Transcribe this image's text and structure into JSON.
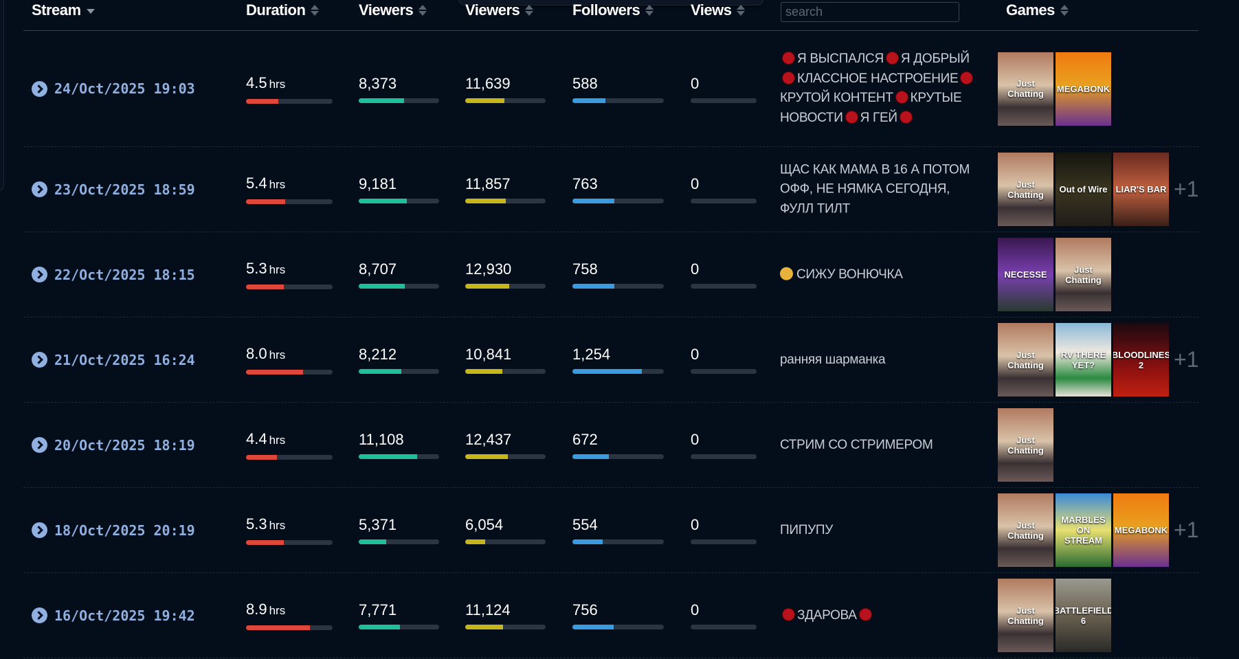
{
  "header": {
    "stream": "Stream",
    "duration": "Duration",
    "viewers_avg": "Viewers",
    "viewers_peak": "Viewers",
    "followers": "Followers",
    "views": "Views",
    "search_placeholder": "search",
    "games": "Games"
  },
  "colors": {
    "duration": "#e0473b",
    "viewers_avg": "#1fbf9c",
    "viewers_peak": "#c6b51b",
    "followers": "#3a9be0",
    "views": "#3a9be0"
  },
  "unit": "hrs",
  "streams": [
    {
      "date": "24/Oct/2025 19:03",
      "duration": "4.5",
      "duration_pct": 37,
      "viewers_avg": "8,373",
      "viewers_avg_pct": 56,
      "viewers_peak": "11,639",
      "viewers_peak_pct": 49,
      "followers": "588",
      "followers_pct": 36,
      "views": "0",
      "views_pct": 0,
      "title": [
        {
          "dot": true
        },
        {
          "t": "Я ВЫСПАЛСЯ"
        },
        {
          "dot": true
        },
        {
          "t": "Я ДОБРЫЙ"
        },
        {
          "dot": true
        },
        {
          "t": "КЛАССНОЕ НАСТРОЕНИЕ"
        },
        {
          "dot": true
        },
        {
          "t": "КРУТОЙ КОНТЕНТ"
        },
        {
          "dot": true
        },
        {
          "t": "КРУТЫЕ НОВОСТИ"
        },
        {
          "dot": true
        },
        {
          "t": "Я ГЕЙ"
        },
        {
          "dot": true
        }
      ],
      "games": [
        "Just Chatting",
        "MEGABONK"
      ],
      "more": ""
    },
    {
      "date": "23/Oct/2025 18:59",
      "duration": "5.4",
      "duration_pct": 45,
      "viewers_avg": "9,181",
      "viewers_avg_pct": 60,
      "viewers_peak": "11,857",
      "viewers_peak_pct": 50,
      "followers": "763",
      "followers_pct": 46,
      "views": "0",
      "views_pct": 0,
      "title": [
        {
          "t": "ЩАС КАК МАМА В 16 А ПОТОМ ОФФ, НЕ НЯМКА СЕГОДНЯ, ФУЛЛ ТИЛТ"
        }
      ],
      "games": [
        "Just Chatting",
        "Out of Wire",
        "LIAR'S BAR"
      ],
      "more": "+1"
    },
    {
      "date": "22/Oct/2025 18:15",
      "duration": "5.3",
      "duration_pct": 44,
      "viewers_avg": "8,707",
      "viewers_avg_pct": 57,
      "viewers_peak": "12,930",
      "viewers_peak_pct": 55,
      "followers": "758",
      "followers_pct": 46,
      "views": "0",
      "views_pct": 0,
      "title": [
        {
          "emoji": true
        },
        {
          "t": "СИЖУ ВОНЮЧКА"
        }
      ],
      "games": [
        "NECESSE",
        "Just Chatting"
      ],
      "more": ""
    },
    {
      "date": "21/Oct/2025 16:24",
      "duration": "8.0",
      "duration_pct": 66,
      "viewers_avg": "8,212",
      "viewers_avg_pct": 53,
      "viewers_peak": "10,841",
      "viewers_peak_pct": 46,
      "followers": "1,254",
      "followers_pct": 76,
      "views": "0",
      "views_pct": 0,
      "title": [
        {
          "t": "ранняя шарманка"
        }
      ],
      "games": [
        "Just Chatting",
        "RV THERE YET?",
        "BLOODLINES 2"
      ],
      "more": "+1"
    },
    {
      "date": "20/Oct/2025 18:19",
      "duration": "4.4",
      "duration_pct": 36,
      "viewers_avg": "11,108",
      "viewers_avg_pct": 73,
      "viewers_peak": "12,437",
      "viewers_peak_pct": 53,
      "followers": "672",
      "followers_pct": 40,
      "views": "0",
      "views_pct": 0,
      "title": [
        {
          "t": "СТРИМ СО СТРИМЕРОМ"
        }
      ],
      "games": [
        "Just Chatting"
      ],
      "more": ""
    },
    {
      "date": "18/Oct/2025 20:19",
      "duration": "5.3",
      "duration_pct": 44,
      "viewers_avg": "5,371",
      "viewers_avg_pct": 34,
      "viewers_peak": "6,054",
      "viewers_peak_pct": 25,
      "followers": "554",
      "followers_pct": 33,
      "views": "0",
      "views_pct": 0,
      "title": [
        {
          "t": "ПИПУПУ"
        }
      ],
      "games": [
        "Just Chatting",
        "MARBLES ON STREAM",
        "MEGABONK"
      ],
      "more": "+1"
    },
    {
      "date": "16/Oct/2025 19:42",
      "duration": "8.9",
      "duration_pct": 74,
      "viewers_avg": "7,771",
      "viewers_avg_pct": 51,
      "viewers_peak": "11,124",
      "viewers_peak_pct": 47,
      "followers": "756",
      "followers_pct": 45,
      "views": "0",
      "views_pct": 0,
      "title": [
        {
          "dot": true
        },
        {
          "t": "ЗДАРОВА"
        },
        {
          "dot": true
        }
      ],
      "games": [
        "Just Chatting",
        "BATTLEFIELD 6"
      ],
      "more": ""
    }
  ]
}
